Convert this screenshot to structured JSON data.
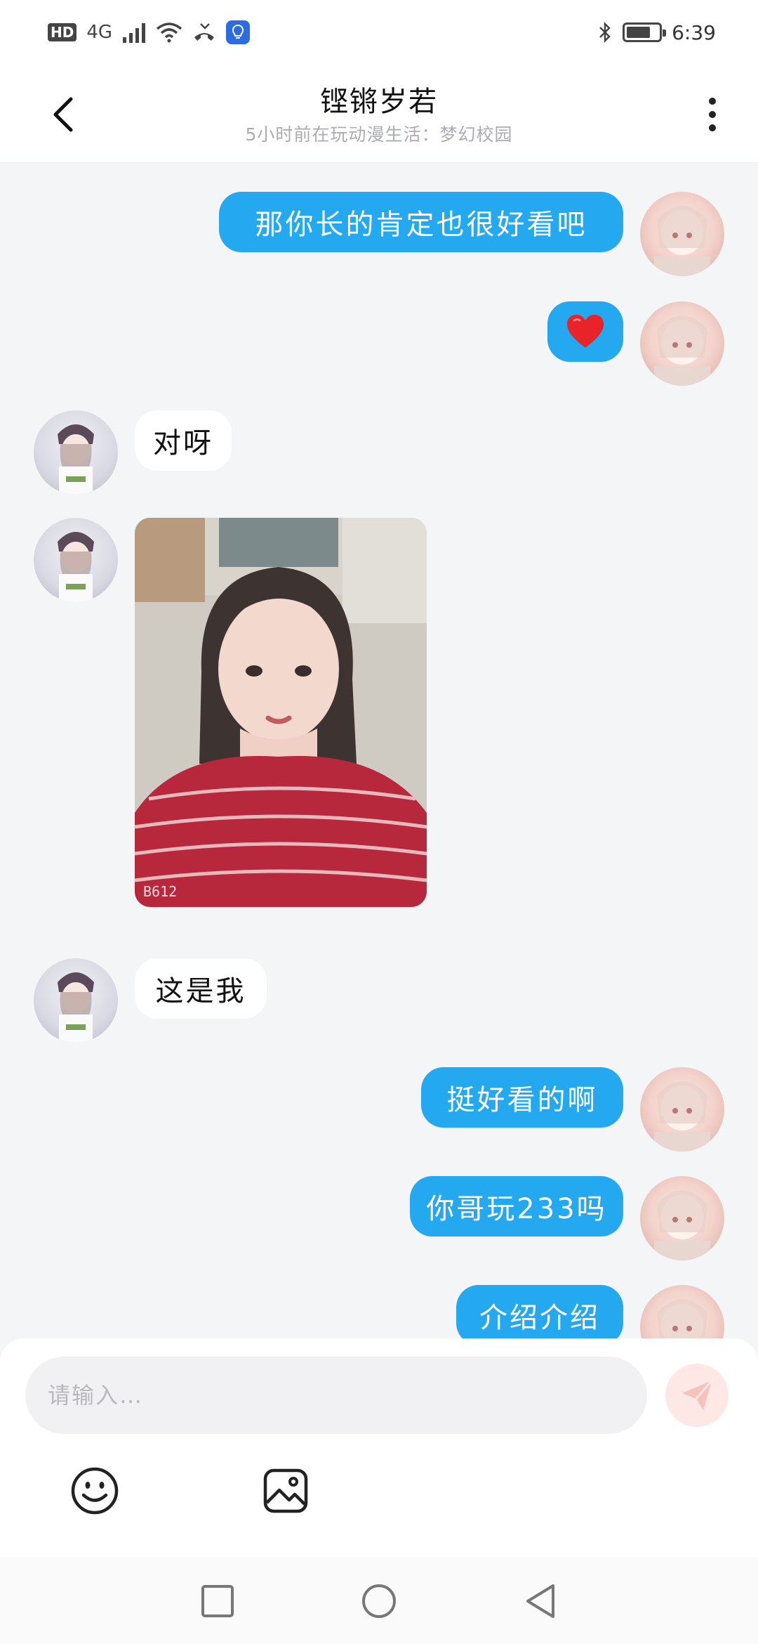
{
  "status_bar": {
    "hd": "HD",
    "network": "4G",
    "time": "6:39",
    "battery_level": 0.75
  },
  "header": {
    "title": "铿锵岁若",
    "subtitle": "5小时前在玩动漫生活：梦幻校园"
  },
  "messages": [
    {
      "side": "right",
      "type": "text",
      "text": "那你长的肯定也很好看吧"
    },
    {
      "side": "right",
      "type": "emoji",
      "icon": "heart-icon"
    },
    {
      "side": "left",
      "type": "text",
      "text": "对呀"
    },
    {
      "side": "left",
      "type": "image",
      "watermark": "B612"
    },
    {
      "side": "left",
      "type": "text",
      "text": "这是我"
    },
    {
      "side": "right",
      "type": "text",
      "text": "挺好看的啊"
    },
    {
      "side": "right",
      "type": "text",
      "text": "你哥玩233吗"
    },
    {
      "side": "right",
      "type": "text",
      "text": "介绍介绍"
    }
  ],
  "input": {
    "placeholder": "请输入…"
  },
  "colors": {
    "accent": "#24a8f0",
    "background": "#f4f5f7",
    "send_button": "#fde8e6"
  }
}
